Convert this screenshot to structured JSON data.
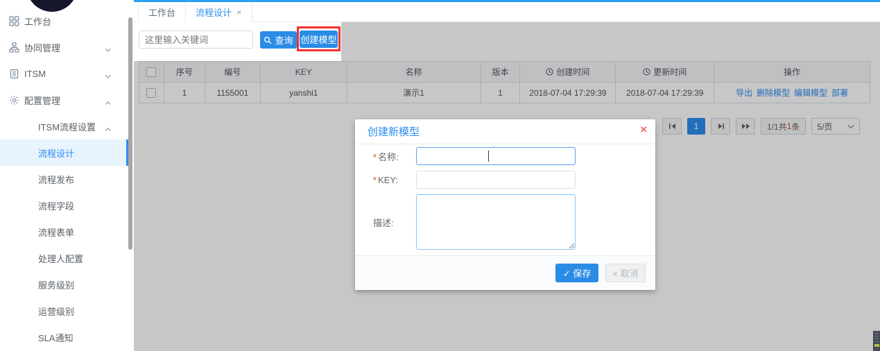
{
  "colors": {
    "primary_blue": "#2d8cf0",
    "button_blue": "#2b8ce6",
    "annotation_red": "#f23030",
    "required_red": "#ed4014",
    "modal_close_red": "#f56c6c",
    "sidebar_active_bg": "#e8f4fd",
    "dim_overlay": "rgba(0,0,0,0.22)"
  },
  "icons": {
    "close": "×",
    "check": "✓"
  },
  "sidebar": {
    "items": [
      {
        "label": "工作台",
        "level": 0,
        "icon": "grid-icon"
      },
      {
        "label": "协同管理",
        "level": 0,
        "icon": "org-icon",
        "chevron": "down"
      },
      {
        "label": "ITSM",
        "level": 0,
        "icon": "doc-icon",
        "chevron": "down"
      },
      {
        "label": "配置管理",
        "level": 0,
        "icon": "gear-icon",
        "chevron": "up"
      },
      {
        "label": "ITSM流程设置",
        "level": 1,
        "chevron": "up"
      },
      {
        "label": "流程设计",
        "level": 2,
        "active": true
      },
      {
        "label": "流程发布",
        "level": 2
      },
      {
        "label": "流程字段",
        "level": 2
      },
      {
        "label": "流程表单",
        "level": 2
      },
      {
        "label": "处理人配置",
        "level": 2
      },
      {
        "label": "服务级别",
        "level": 2
      },
      {
        "label": "运营级别",
        "level": 2
      },
      {
        "label": "SLA通知",
        "level": 2
      }
    ]
  },
  "tabs": [
    {
      "label": "工作台",
      "active": false
    },
    {
      "label": "流程设计",
      "active": true,
      "closable": true
    }
  ],
  "toolbar": {
    "search_placeholder": "这里输入关键词",
    "search_value": "",
    "query_label": "查询",
    "create_label": "创建模型"
  },
  "table": {
    "columns": [
      "序号",
      "编号",
      "KEY",
      "名称",
      "版本",
      "创建时间",
      "更新时间",
      "操作"
    ],
    "rows": [
      {
        "index": "1",
        "code": "1155001",
        "key": "yanshi1",
        "name": "演示1",
        "version": "1",
        "created": "2018-07-04 17:29:39",
        "updated": "2018-07-04 17:29:39",
        "actions": [
          "导出",
          "删除模型",
          "编辑模型",
          "部署"
        ]
      }
    ]
  },
  "pagination": {
    "current_page": "1",
    "info_prefix": "1/1共",
    "info_count": "1",
    "info_suffix": "条",
    "page_size": "5/页"
  },
  "modal": {
    "title": "创建新模型",
    "fields": {
      "name_label": "名称:",
      "key_label": "KEY:",
      "desc_label": "描述:",
      "required_mark": "*",
      "name_value": "",
      "key_value": "",
      "desc_value": ""
    },
    "save_label": "保存",
    "cancel_label": "取消"
  }
}
